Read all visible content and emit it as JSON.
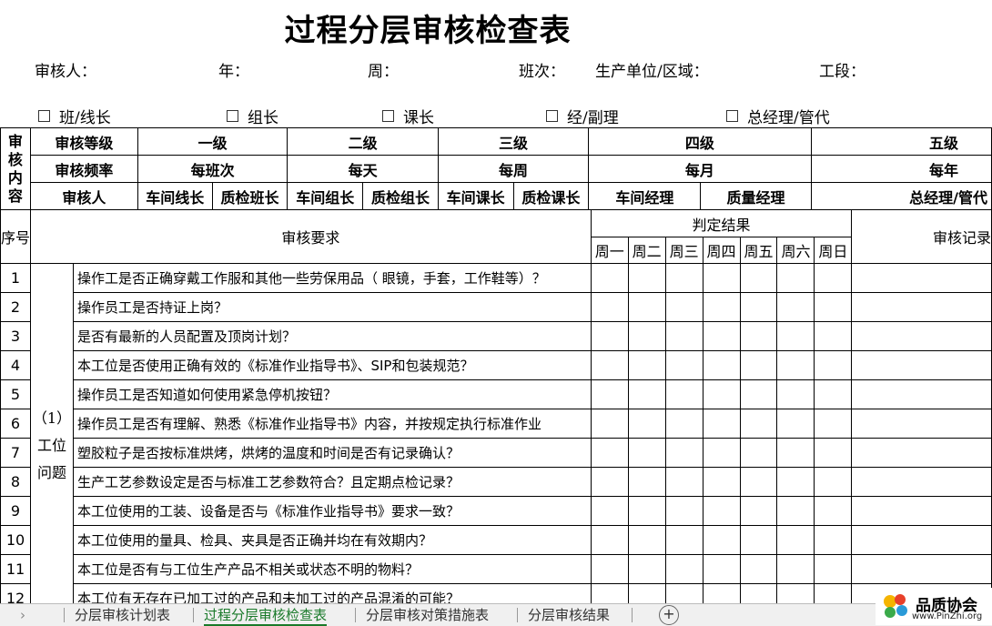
{
  "title": "过程分层审核检查表",
  "header_fields": {
    "auditor": "审核人：",
    "year": "年：",
    "week": "周：",
    "shift": "班次：",
    "unit": "生产单位/区域：",
    "station": "工段："
  },
  "roles": [
    "班/线长",
    "组长",
    "课长",
    "经/副理",
    "总经理/管代"
  ],
  "audit_grid": {
    "side_label": "审核内容",
    "level_label": "审核等级",
    "freq_label": "审核频率",
    "auditor_label": "审核人",
    "levels": [
      "一级",
      "二级",
      "三级",
      "四级",
      "五级"
    ],
    "frequencies": [
      "每班次",
      "每天",
      "每周",
      "每月",
      "每年"
    ],
    "auditors": [
      "车间线长",
      "质检班长",
      "车间组长",
      "质检组长",
      "车间课长",
      "质检课长",
      "车间经理",
      "质量经理",
      "总经理/管代"
    ]
  },
  "main_table": {
    "seq_header": "序号",
    "req_header": "审核要求",
    "result_header": "判定结果",
    "record_header": "审核记录",
    "days": [
      "周一",
      "周二",
      "周三",
      "周四",
      "周五",
      "周六",
      "周日"
    ],
    "category": "（1）工位问题",
    "rows": [
      {
        "no": "1",
        "req": "操作工是否正确穿戴工作服和其他一些劳保用品（ 眼镜，手套，工作鞋等）？"
      },
      {
        "no": "2",
        "req": "操作员工是否持证上岗？"
      },
      {
        "no": "3",
        "req": "是否有最新的人员配置及顶岗计划？"
      },
      {
        "no": "4",
        "req": "本工位是否使用正确有效的《标准作业指导书》、SIP和包装规范？"
      },
      {
        "no": "5",
        "req": "操作员工是否知道如何使用紧急停机按钮？"
      },
      {
        "no": "6",
        "req": "操作员工是否有理解、熟悉《标准作业指导书》内容，并按规定执行标准作业"
      },
      {
        "no": "7",
        "req": "塑胶粒子是否按标准烘烤，烘烤的温度和时间是否有记录确认？"
      },
      {
        "no": "8",
        "req": "生产工艺参数设定是否与标准工艺参数符合？且定期点检记录？"
      },
      {
        "no": "9",
        "req": "本工位使用的工装、设备是否与《标准作业指导书》要求一致？"
      },
      {
        "no": "10",
        "req": "本工位使用的量具、检具、夹具是否正确并均在有效期内？"
      },
      {
        "no": "11",
        "req": "本工位是否有与工位生产产品不相关或状态不明的物料？"
      },
      {
        "no": "12",
        "req": "本工位有无存在已加工过的产品和未加工过的产品混淆的可能？"
      }
    ]
  },
  "sheet_tabs": [
    "分层审核计划表",
    "过程分层审核检查表",
    "分层审核对策措施表",
    "分层审核结果"
  ],
  "active_tab": "过程分层审核检查表",
  "add_sheet_icon": "plus-circle-icon",
  "watermark": {
    "name": "品质协会",
    "url": "www.PinZhi.org"
  }
}
